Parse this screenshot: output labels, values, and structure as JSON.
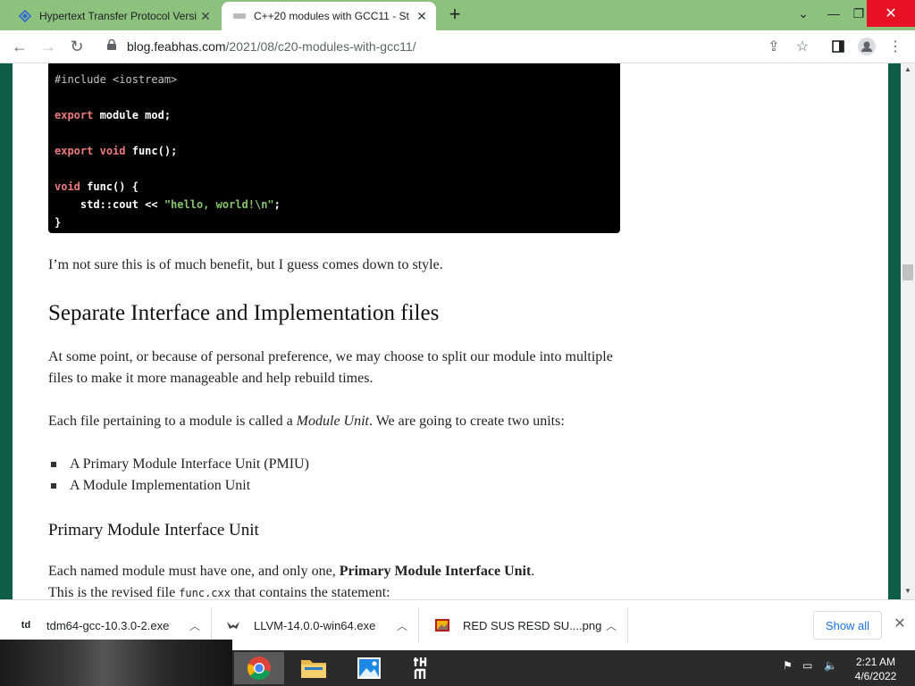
{
  "tabs": [
    {
      "label": "Hypertext Transfer Protocol Versi",
      "favicon": "globe-icon",
      "active": false
    },
    {
      "label": "C++20 modules with GCC11 - St",
      "favicon": "page-icon",
      "active": true
    }
  ],
  "toolbar": {
    "url_host": "blog.feabhas.com",
    "url_path": "/2021/08/c20-modules-with-gcc11/"
  },
  "code": {
    "lines": [
      "#include <iostream>",
      "",
      "export module mod;",
      "",
      "export void func();",
      "",
      "void func() {",
      "    std::cout << \"hello, world!\\n\";",
      "}"
    ]
  },
  "article": {
    "para1": "I’m not sure this is of much benefit, but I guess comes down to style.",
    "heading1": "Separate Interface and Implementation files",
    "para2": "At some point, or because of personal preference, we may choose to split our module into multiple files to make it more manageable and help rebuild times.",
    "para3_before": "Each file pertaining to a module is called a ",
    "para3_em": "Module Unit",
    "para3_after": ". We are going to create two units:",
    "bullets": [
      "A Primary Module Interface Unit (PMIU)",
      "A Module Implementation Unit"
    ],
    "heading2": "Primary Module Interface Unit",
    "para4_before": "Each named module must have one, and only one, ",
    "para4_bold": "Primary Module Interface Unit",
    "para4_after": ".",
    "para5_before": "This is the revised file ",
    "para5_code": "func.cxx",
    "para5_after": " that contains the statement:"
  },
  "downloads": {
    "items": [
      {
        "name": "tdm64-gcc-10.3.0-2.exe",
        "icon": "tdm-icon"
      },
      {
        "name": "LLVM-14.0.0-win64.exe",
        "icon": "llvm-dragon-icon"
      },
      {
        "name": "RED SUS RESD SU....png",
        "icon": "image-file-icon"
      }
    ],
    "show_all": "Show all"
  },
  "taskbar": {
    "time": "2:21 AM",
    "date": "4/6/2022"
  }
}
